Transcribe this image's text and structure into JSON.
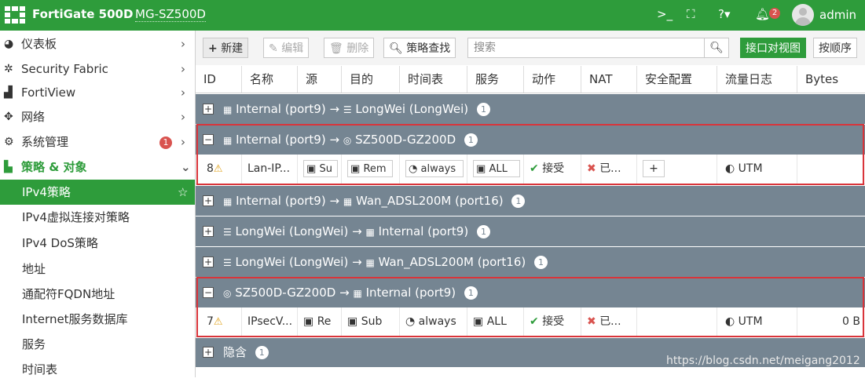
{
  "topbar": {
    "brand": "FortiGate 500D",
    "hostname": "MG-SZ500D",
    "bell_count": "2",
    "username": "admin"
  },
  "sidebar": {
    "items": [
      {
        "label": "仪表板",
        "icon": "dashboard-icon"
      },
      {
        "label": "Security Fabric",
        "icon": "fabric-icon"
      },
      {
        "label": "FortiView",
        "icon": "chart-icon"
      },
      {
        "label": "网络",
        "icon": "network-icon"
      },
      {
        "label": "系统管理",
        "icon": "gear-icon",
        "badge": "1"
      },
      {
        "label": "策略 & 对象",
        "icon": "policy-icon"
      },
      {
        "label": "IPv4策略"
      },
      {
        "label": "IPv4虚拟连接对策略"
      },
      {
        "label": "IPv4 DoS策略"
      },
      {
        "label": "地址"
      },
      {
        "label": "通配符FQDN地址"
      },
      {
        "label": "Internet服务数据库"
      },
      {
        "label": "服务"
      },
      {
        "label": "时间表"
      }
    ]
  },
  "toolbar": {
    "new": "新建",
    "edit": "编辑",
    "delete": "删除",
    "lookup": "策略查找",
    "search_placeholder": "搜索",
    "view_interface": "接口对视图",
    "view_sequence": "按顺序"
  },
  "columns": [
    "ID",
    "名称",
    "源",
    "目的",
    "时间表",
    "服务",
    "动作",
    "NAT",
    "安全配置",
    "流量日志",
    "Bytes"
  ],
  "groups": [
    {
      "expand": "+",
      "src": "Internal (port9)",
      "arrow": "→",
      "dst": "LongWei (LongWei)",
      "count": "1"
    },
    {
      "expand": "−",
      "src": "Internal (port9)",
      "arrow": "→",
      "dst": "SZ500D-GZ200D",
      "count": "1"
    },
    {
      "expand": "+",
      "src": "Internal (port9)",
      "arrow": "→",
      "dst": "Wan_ADSL200M (port16)",
      "count": "1"
    },
    {
      "expand": "+",
      "src": "LongWei (LongWei)",
      "arrow": "→",
      "dst": "Internal (port9)",
      "count": "1"
    },
    {
      "expand": "+",
      "src": "LongWei (LongWei)",
      "arrow": "→",
      "dst": "Wan_ADSL200M (port16)",
      "count": "1"
    },
    {
      "expand": "−",
      "src": "SZ500D-GZ200D",
      "arrow": "→",
      "dst": "Internal (port9)",
      "count": "1"
    },
    {
      "expand": "+",
      "src": "隐含",
      "arrow": "",
      "dst": "",
      "count": "1"
    }
  ],
  "rows": [
    {
      "id": "8",
      "name": "Lan-IP...",
      "src": "Su",
      "dst": "Rem",
      "schedule": "always",
      "service": "ALL",
      "action": "接受",
      "nat": "已...",
      "security": "+",
      "log": "UTM",
      "bytes": ""
    },
    {
      "id": "7",
      "name": "IPsecV...",
      "src": "Re",
      "dst": "Sub",
      "schedule": "always",
      "service": "ALL",
      "action": "接受",
      "nat": "已...",
      "security": "",
      "log": "UTM",
      "bytes": "0 B"
    }
  ],
  "watermark": "https://blog.csdn.net/meigang2012",
  "colors": {
    "brand_green": "#2e9c3b",
    "group_gray": "#758592",
    "highlight_red": "#d9343a"
  }
}
